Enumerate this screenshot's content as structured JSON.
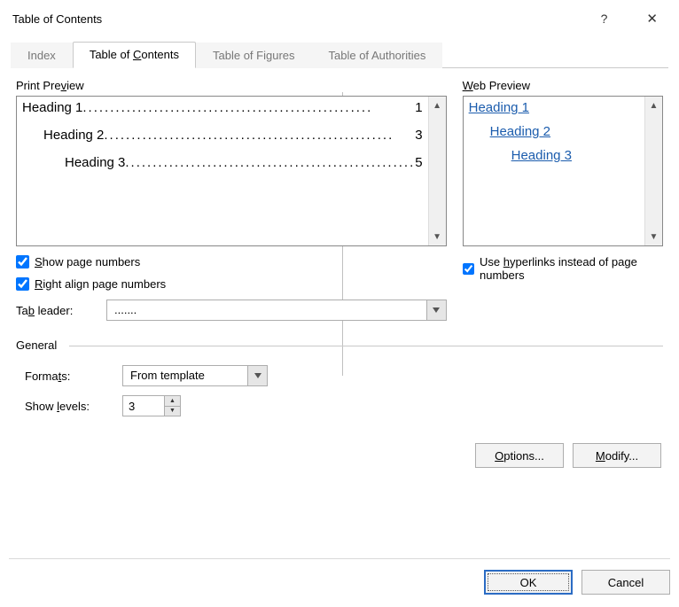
{
  "title": "Table of Contents",
  "tabs": {
    "index": "Index",
    "toc_pre": "Table of ",
    "toc_mn": "C",
    "toc_post": "ontents",
    "figures": "Table of Figures",
    "authorities": "Table of Authorities"
  },
  "print_preview": {
    "label_pre": "Print Pre",
    "label_mn": "v",
    "label_post": "iew",
    "items": [
      {
        "text": "Heading 1",
        "page": "1",
        "indent": 0
      },
      {
        "text": "Heading 2",
        "page": "3",
        "indent": 1
      },
      {
        "text": "Heading 3",
        "page": "5",
        "indent": 2
      }
    ]
  },
  "web_preview": {
    "label_mn": "W",
    "label_post": "eb Preview",
    "items": [
      {
        "text": "Heading 1",
        "indent": 0
      },
      {
        "text": "Heading 2",
        "indent": 1
      },
      {
        "text": "Heading 3",
        "indent": 2
      }
    ]
  },
  "checks": {
    "show_pn_mn": "S",
    "show_pn_post": "how page numbers",
    "right_align_mn": "R",
    "right_align_post": "ight align page numbers",
    "hyperlinks_pre": "Use ",
    "hyperlinks_mn": "h",
    "hyperlinks_post": "yperlinks instead of page numbers"
  },
  "tab_leader": {
    "label_pre": "Ta",
    "label_mn": "b",
    "label_post": " leader:",
    "value": "......."
  },
  "general": {
    "legend": "General",
    "formats_label_pre": "Forma",
    "formats_label_mn": "t",
    "formats_label_post": "s:",
    "formats_value": "From template",
    "levels_label_pre": "Show ",
    "levels_label_mn": "l",
    "levels_label_post": "evels:",
    "levels_value": "3"
  },
  "buttons": {
    "options_mn": "O",
    "options_post": "ptions...",
    "modify_mn": "M",
    "modify_post": "odify...",
    "ok": "OK",
    "cancel": "Cancel"
  }
}
